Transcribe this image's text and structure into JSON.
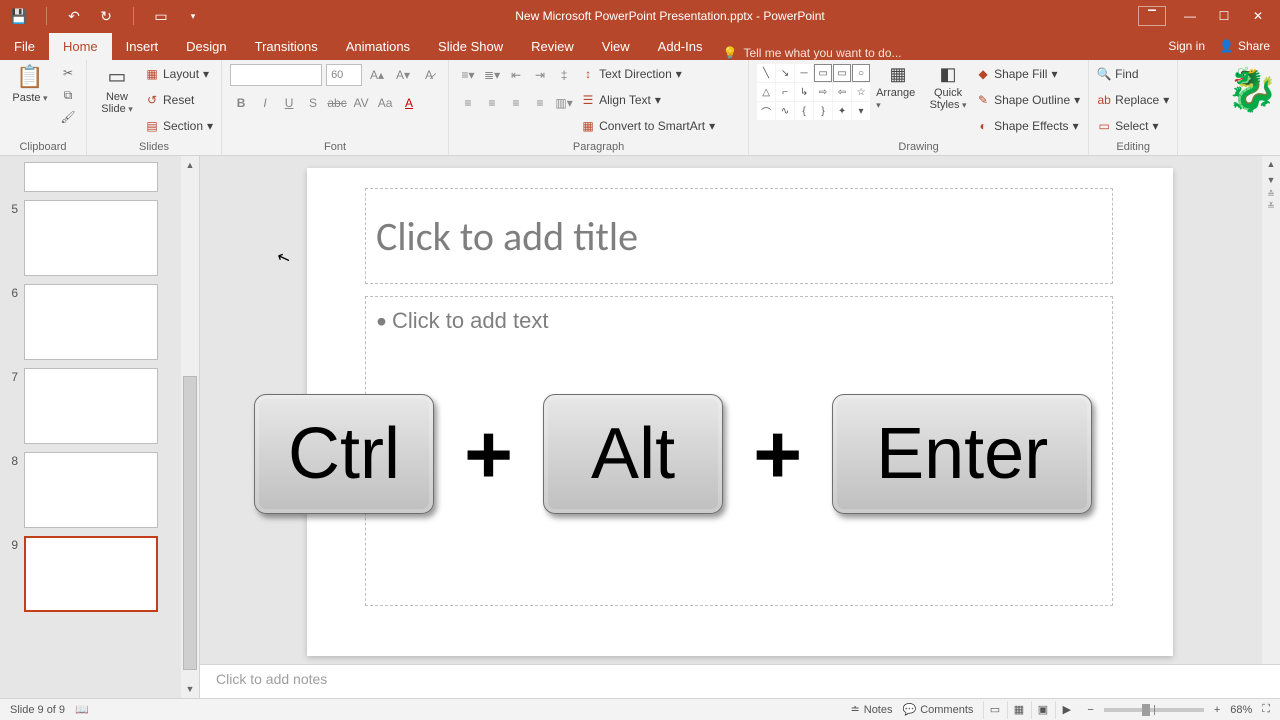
{
  "app": {
    "title": "New Microsoft PowerPoint Presentation.pptx - PowerPoint"
  },
  "tabs": {
    "file": "File",
    "home": "Home",
    "insert": "Insert",
    "design": "Design",
    "transitions": "Transitions",
    "animations": "Animations",
    "slideshow": "Slide Show",
    "review": "Review",
    "view": "View",
    "addins": "Add-Ins",
    "tellme": "Tell me what you want to do...",
    "signin": "Sign in",
    "share": "Share"
  },
  "ribbon": {
    "clipboard": {
      "paste": "Paste",
      "label": "Clipboard"
    },
    "slides": {
      "newslide": "New\nSlide",
      "layout": "Layout",
      "reset": "Reset",
      "section": "Section",
      "label": "Slides"
    },
    "font": {
      "size": "60",
      "label": "Font"
    },
    "paragraph": {
      "textdir": "Text Direction",
      "align": "Align Text",
      "smartart": "Convert to SmartArt",
      "label": "Paragraph"
    },
    "drawing": {
      "arrange": "Arrange",
      "quick": "Quick\nStyles",
      "fill": "Shape Fill",
      "outline": "Shape Outline",
      "effects": "Shape Effects",
      "label": "Drawing"
    },
    "editing": {
      "find": "Find",
      "replace": "Replace",
      "select": "Select",
      "label": "Editing"
    }
  },
  "thumbs": {
    "visible": [
      "",
      "5",
      "6",
      "7",
      "8",
      "9"
    ],
    "selected_index": 5
  },
  "slide": {
    "title_placeholder": "Click to add title",
    "body_placeholder": "Click to add text"
  },
  "overlay": {
    "key1": "Ctrl",
    "plus": "+",
    "key2": "Alt",
    "key3": "Enter"
  },
  "notes": {
    "placeholder": "Click to add notes"
  },
  "status": {
    "slide_of": "Slide 9 of 9",
    "notes": "Notes",
    "comments": "Comments",
    "zoom": "68%"
  }
}
